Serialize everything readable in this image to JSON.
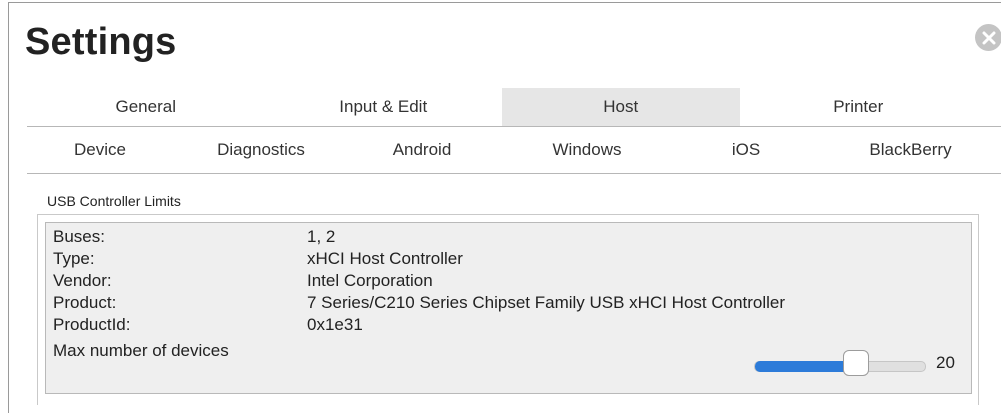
{
  "window": {
    "title": "Settings"
  },
  "tabs_primary": [
    {
      "label": "General"
    },
    {
      "label": "Input & Edit"
    },
    {
      "label": "Host"
    },
    {
      "label": "Printer"
    }
  ],
  "active_primary_tab": "Host",
  "tabs_secondary": [
    {
      "label": "Device"
    },
    {
      "label": "Diagnostics"
    },
    {
      "label": "Android"
    },
    {
      "label": "Windows"
    },
    {
      "label": "iOS"
    },
    {
      "label": "BlackBerry"
    }
  ],
  "usb": {
    "section_title": "USB Controller Limits",
    "rows": [
      {
        "key": "Buses:",
        "value": "1, 2"
      },
      {
        "key": "Type:",
        "value": "xHCI Host Controller"
      },
      {
        "key": "Vendor:",
        "value": "Intel Corporation"
      },
      {
        "key": "Product:",
        "value": "7 Series/C210 Series Chipset Family USB xHCI Host Controller"
      },
      {
        "key": "ProductId:",
        "value": "0x1e31"
      }
    ],
    "max_devices": {
      "label": "Max number of devices",
      "value": "20",
      "slider_fraction": 0.6
    }
  },
  "colors": {
    "slider_fill": "#2c7bd9",
    "active_tab": "#e6e6e6"
  },
  "icons": {
    "close": "close-icon"
  }
}
